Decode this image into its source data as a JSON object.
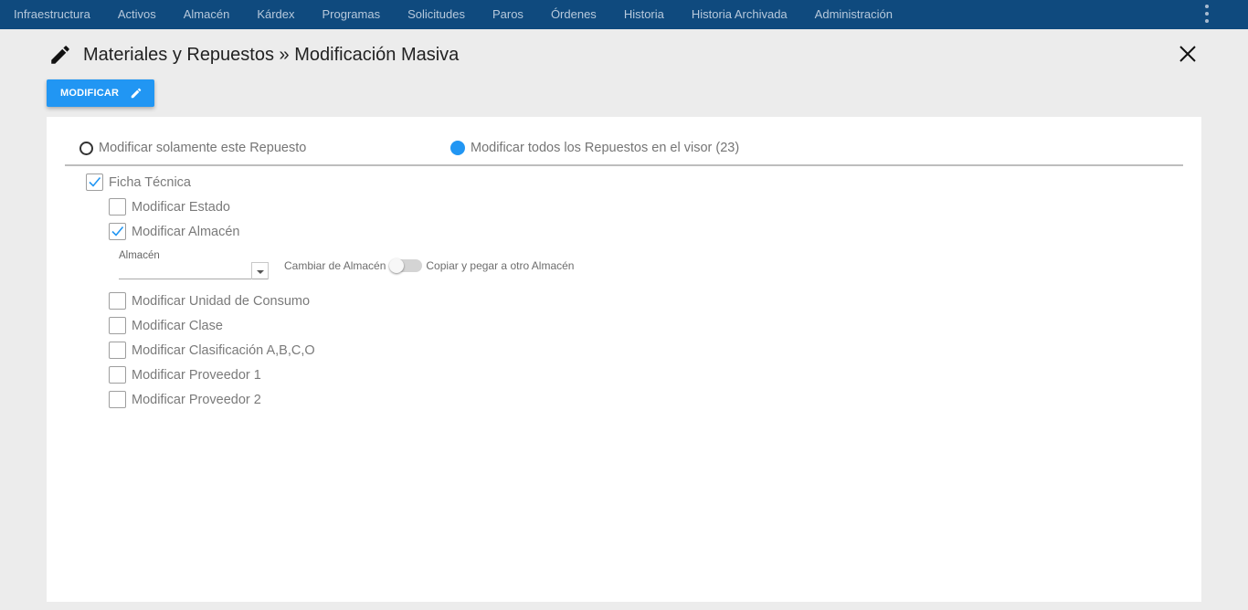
{
  "nav": {
    "items": [
      "Infraestructura",
      "Activos",
      "Almacén",
      "Kárdex",
      "Programas",
      "Solicitudes",
      "Paros",
      "Órdenes",
      "Historia",
      "Historia Archivada",
      "Administración"
    ],
    "menu_icon": "more-vertical-icon"
  },
  "header": {
    "title": "Materiales y Repuestos » Modificación Masiva",
    "icon": "pencil-icon",
    "close_icon": "close-icon"
  },
  "toolbar": {
    "modify_label": "MODIFICAR",
    "modify_icon": "pencil-icon"
  },
  "scope": {
    "option_single": "Modificar solamente este Repuesto",
    "option_all": "Modificar todos los Repuestos en el visor (23)",
    "selected": "all"
  },
  "ficha": {
    "label": "Ficha Técnica",
    "checked": true
  },
  "options": [
    {
      "label": "Modificar Estado",
      "checked": false
    },
    {
      "label": "Modificar Almacén",
      "checked": true
    },
    {
      "label": "Modificar Unidad de Consumo",
      "checked": false
    },
    {
      "label": "Modificar Clase",
      "checked": false
    },
    {
      "label": "Modificar Clasificación A,B,C,O",
      "checked": false
    },
    {
      "label": "Modificar Proveedor 1",
      "checked": false
    },
    {
      "label": "Modificar Proveedor 2",
      "checked": false
    }
  ],
  "almacen": {
    "field_label": "Almacén",
    "value": "",
    "toggle_left": "Cambiar de Almacén",
    "toggle_right": "Copiar y pegar a otro Almacén",
    "toggle_on": false
  },
  "colors": {
    "nav_bg": "#0f4a7e",
    "accent": "#2196f3",
    "check": "#2196f3"
  }
}
